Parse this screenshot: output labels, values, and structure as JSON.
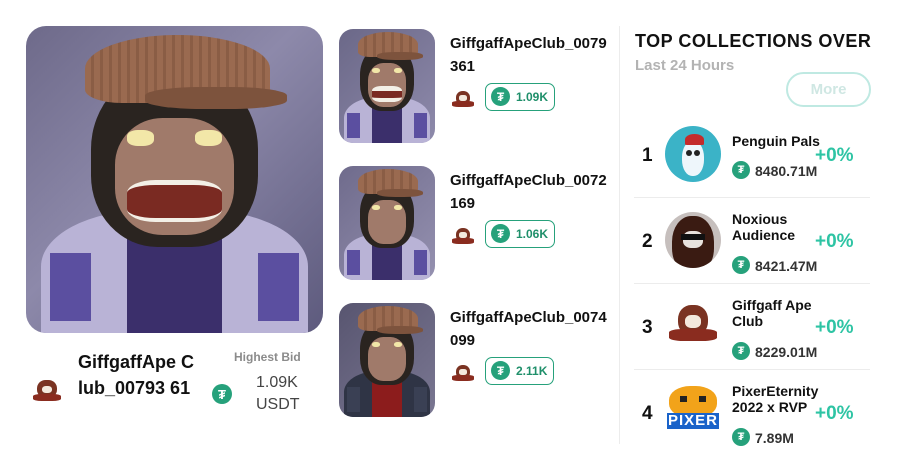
{
  "featured": {
    "name": "GiffgaffApe Club_0079361",
    "name_display": "GiffgaffApe Club_00793 61",
    "highest_bid_label": "Highest Bid",
    "bid_value": "1.09K",
    "bid_unit": "USDT"
  },
  "nft_list": [
    {
      "name": "GiffgaffApeClub_0079361",
      "price": "1.09K"
    },
    {
      "name": "GiffgaffApeClub_0072169",
      "price": "1.06K"
    },
    {
      "name": "GiffgaffApeClub_0074099",
      "price": "2.11K"
    }
  ],
  "top_collections": {
    "title": "TOP COLLECTIONS OVER",
    "subtitle": "Last 24 Hours",
    "more_label": "More",
    "items": [
      {
        "rank": "1",
        "name": "Penguin Pals",
        "volume": "8480.71M",
        "change": "+0%"
      },
      {
        "rank": "2",
        "name": "Noxious Audience",
        "volume": "8421.47M",
        "change": "+0%"
      },
      {
        "rank": "3",
        "name": "Giffgaff Ape Club",
        "volume": "8229.01M",
        "change": "+0%"
      },
      {
        "rank": "4",
        "name": "PixerEternity 2022 x RVP",
        "volume": "7.89M",
        "change": "+0%"
      }
    ]
  },
  "icons": {
    "currency": "usdt-tether-icon",
    "collection_logo": "giffgaff-ape-logo-icon"
  },
  "colors": {
    "accent_green": "#26a17b",
    "change_green": "#2ec4a4",
    "more_border": "#bfe9e2"
  }
}
